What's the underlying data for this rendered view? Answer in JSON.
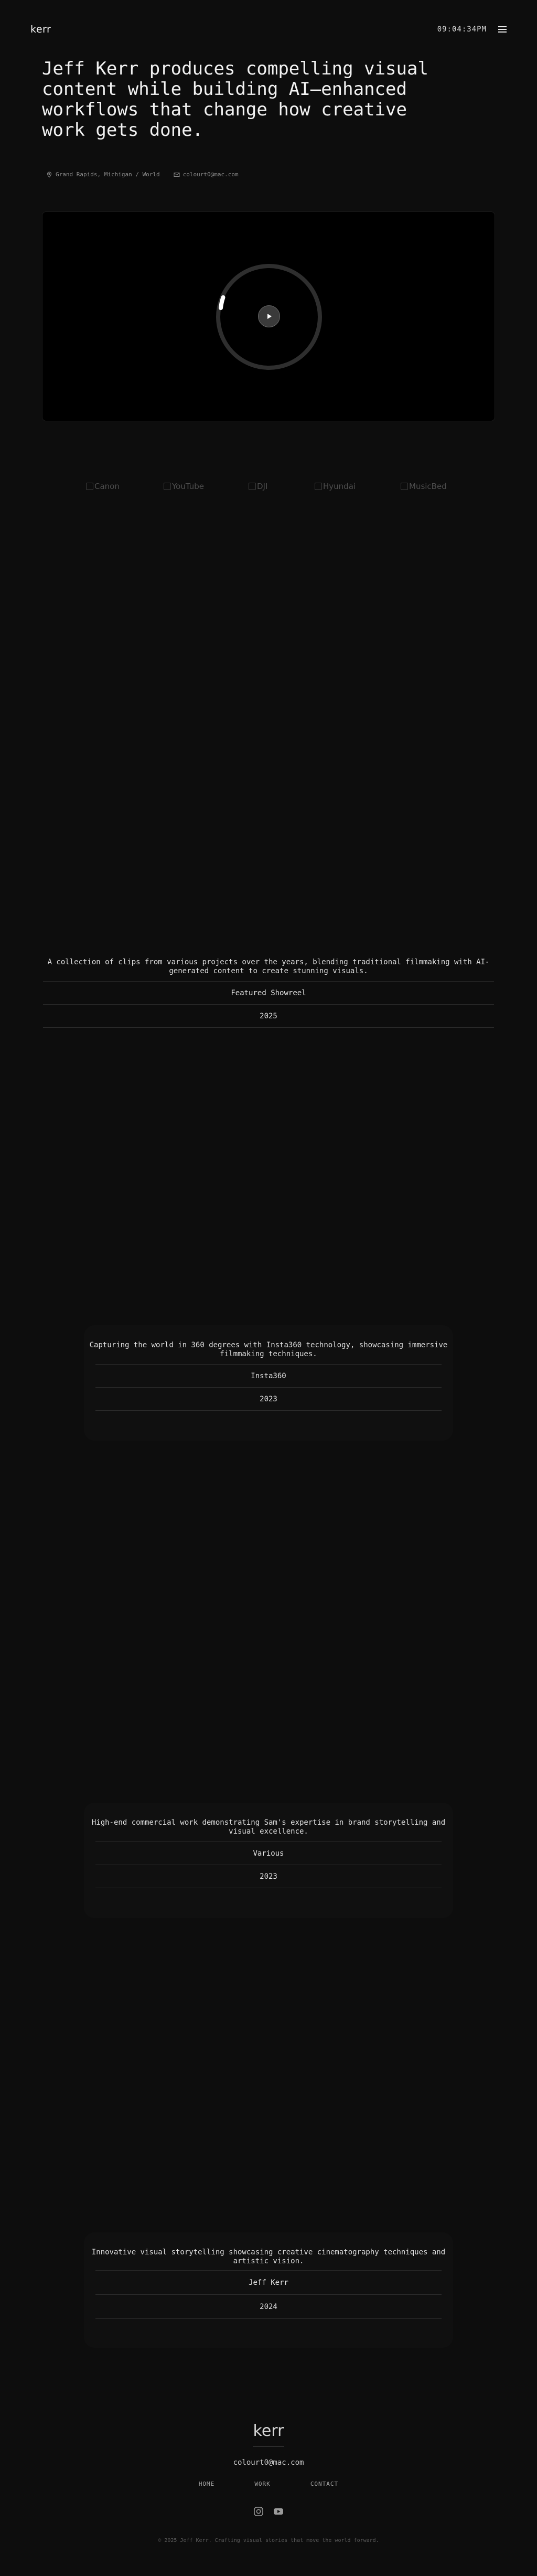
{
  "header": {
    "logo": "kerr",
    "clock": "09:04:34PM",
    "menu_icon": "menu-icon"
  },
  "hero": {
    "title": "Jeff Kerr produces compelling visual content while building AI–enhanced workflows that change how creative work gets done.",
    "location": "Grand Rapids, Michigan / World",
    "email": "colourt0@mac.com"
  },
  "video": {
    "play_icon": "play-icon",
    "progress": 0.03
  },
  "clients": [
    {
      "name": "Canon"
    },
    {
      "name": "YouTube"
    },
    {
      "name": "DJI"
    },
    {
      "name": "Hyundai"
    },
    {
      "name": "MusicBed"
    }
  ],
  "projects": [
    {
      "description": "A collection of clips from various projects over the years, blending traditional filmmaking with AI-generated content to create stunning visuals.",
      "client": "Featured Showreel",
      "year": "2025"
    },
    {
      "description": "Capturing the world in 360 degrees with Insta360 technology, showcasing immersive filmmaking techniques.",
      "client": "Insta360",
      "year": "2023"
    },
    {
      "description": "High-end commercial work demonstrating Sam's expertise in brand storytelling and visual excellence.",
      "client": "Various",
      "year": "2023"
    },
    {
      "description": "Innovative visual storytelling showcasing creative cinematography techniques and artistic vision.",
      "client": "Jeff Kerr",
      "year": "2024"
    }
  ],
  "footer": {
    "logo": "kerr",
    "email": "colourt0@mac.com",
    "nav": [
      "HOME",
      "WORK",
      "CONTACT"
    ],
    "social": [
      "instagram-icon",
      "youtube-icon"
    ],
    "copyright": "2025 Jeff Kerr. Crafting visual stories that move the world forward."
  },
  "colors": {
    "background": "#0d0d0d",
    "text": "#e8e8e8",
    "muted": "#8a8a8a"
  }
}
